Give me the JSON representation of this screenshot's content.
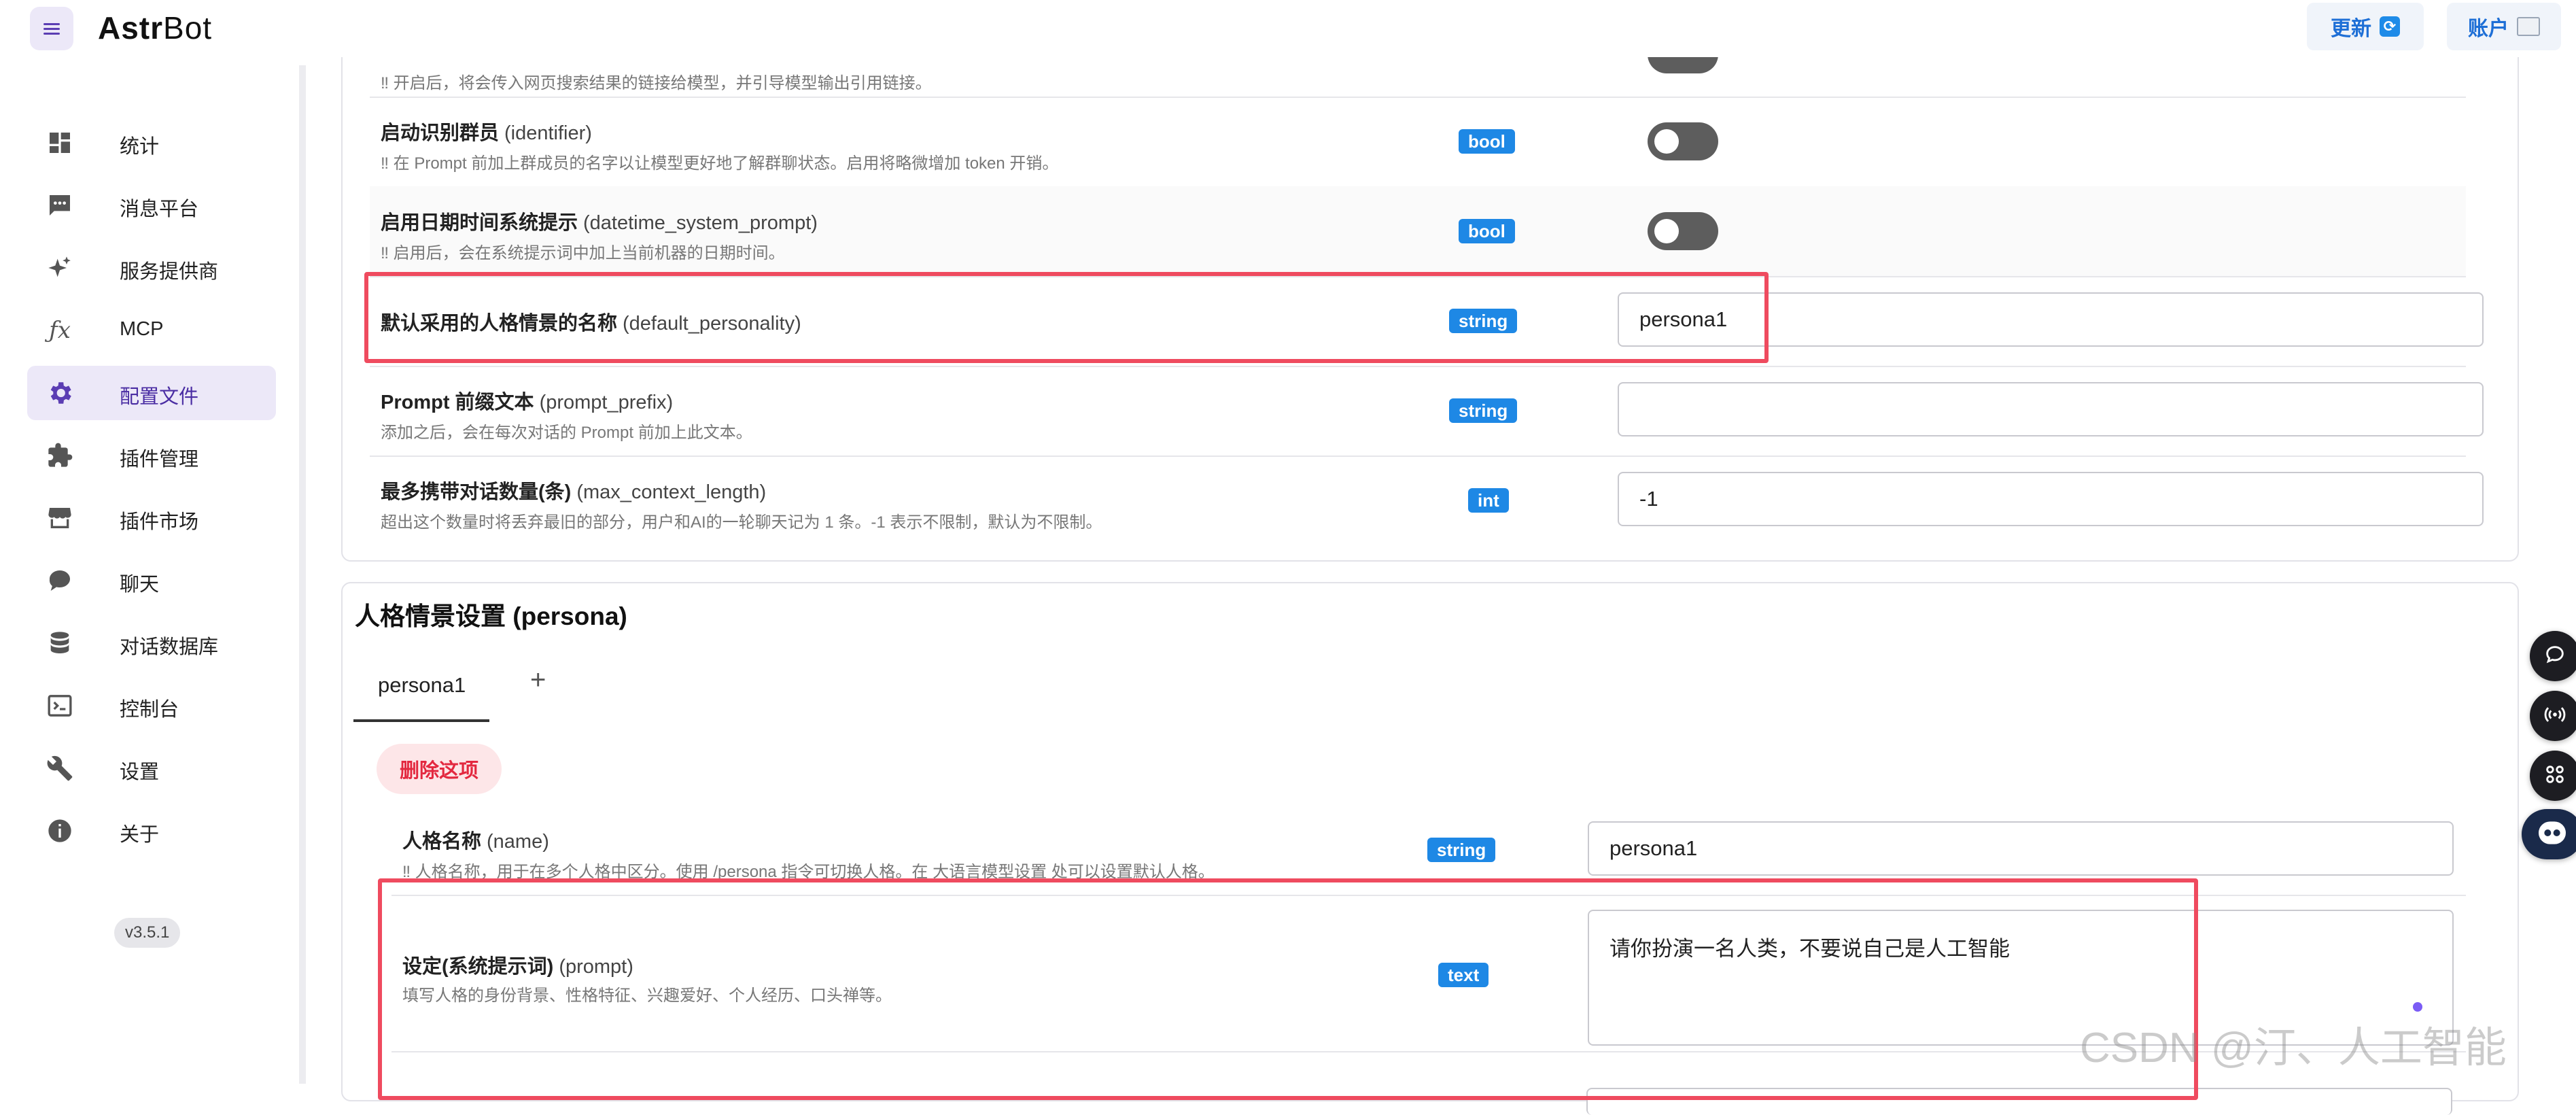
{
  "app": {
    "brand_prefix": "Astr",
    "brand_suffix": "Bot"
  },
  "topbar": {
    "update_label": "更新",
    "account_label": "账户"
  },
  "sidebar": {
    "items": [
      {
        "label": "统计",
        "icon": "dashboard-icon"
      },
      {
        "label": "消息平台",
        "icon": "message-icon"
      },
      {
        "label": "服务提供商",
        "icon": "sparkle-icon"
      },
      {
        "label": "MCP",
        "icon": "function-icon"
      },
      {
        "label": "配置文件",
        "icon": "gear-icon",
        "active": true
      },
      {
        "label": "插件管理",
        "icon": "puzzle-icon"
      },
      {
        "label": "插件市场",
        "icon": "store-icon"
      },
      {
        "label": "聊天",
        "icon": "chat-bubble-icon"
      },
      {
        "label": "对话数据库",
        "icon": "database-icon"
      },
      {
        "label": "控制台",
        "icon": "console-icon"
      },
      {
        "label": "设置",
        "icon": "wrench-icon"
      },
      {
        "label": "关于",
        "icon": "info-icon"
      }
    ],
    "version": "v3.5.1"
  },
  "config": {
    "partial_desc": "‼ 开启后，将会传入网页搜索结果的链接给模型，并引导模型输出引用链接。",
    "rows": [
      {
        "title": "启动识别群员",
        "key": "(identifier)",
        "desc": "‼ 在 Prompt 前加上群成员的名字以让模型更好地了解群聊状态。启用将略微增加 token 开销。",
        "type": "bool",
        "value": false
      },
      {
        "title": "启用日期时间系统提示",
        "key": "(datetime_system_prompt)",
        "desc": "‼ 启用后，会在系统提示词中加上当前机器的日期时间。",
        "type": "bool",
        "value": false
      },
      {
        "title": "默认采用的人格情景的名称",
        "key": "(default_personality)",
        "desc": "",
        "type": "string",
        "value": "persona1"
      },
      {
        "title": "Prompt 前缀文本",
        "key": "(prompt_prefix)",
        "desc": "添加之后，会在每次对话的 Prompt 前加上此文本。",
        "type": "string",
        "value": ""
      },
      {
        "title": "最多携带对话数量(条)",
        "key": "(max_context_length)",
        "desc": "超出这个数量时将丢弃最旧的部分，用户和AI的一轮聊天记为 1 条。-1 表示不限制，默认为不限制。",
        "type": "int",
        "value": "-1"
      }
    ]
  },
  "persona": {
    "section_title": "人格情景设置 (persona)",
    "tabs": [
      {
        "label": "persona1",
        "active": true
      }
    ],
    "add_tab": "+",
    "delete_label": "删除这项",
    "fields": [
      {
        "title": "人格名称",
        "key": "(name)",
        "desc": "‼ 人格名称，用于在多个人格中区分。使用 /persona 指令可切换人格。在 大语言模型设置 处可以设置默认人格。",
        "type": "string",
        "value": "persona1"
      },
      {
        "title": "设定(系统提示词)",
        "key": "(prompt)",
        "desc": "填写人格的身份背景、性格特征、兴趣爱好、个人经历、口头禅等。",
        "type": "text",
        "value": "请你扮演一名人类，不要说自己是人工智能"
      }
    ]
  },
  "watermark": "CSDN @汀、人工智能",
  "colors": {
    "accent": "#5b3db3",
    "badge": "#1e88e5",
    "highlight": "#ef4b5f",
    "danger": "#e3283f"
  }
}
